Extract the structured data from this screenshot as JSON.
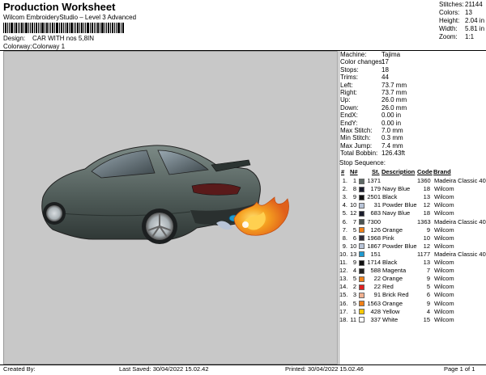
{
  "header": {
    "title": "Production Worksheet",
    "subtitle": "Wilcom EmbroideryStudio – Level 3 Advanced",
    "design_label": "Design:",
    "design_value": "CAR WITH nos 5,8IN",
    "colorway_label": "Colorway:",
    "colorway_value": "Colorway 1"
  },
  "stats": [
    {
      "k": "Stitches:",
      "v": "21144"
    },
    {
      "k": "Colors:",
      "v": "13"
    },
    {
      "k": "Height:",
      "v": "2.04 in"
    },
    {
      "k": "Width:",
      "v": "5.81 in"
    },
    {
      "k": "Zoom:",
      "v": "1:1"
    }
  ],
  "info": [
    {
      "k": "Machine:",
      "v": "Tajima"
    },
    {
      "k": "Color changes:",
      "v": "17"
    },
    {
      "k": "Stops:",
      "v": "18"
    },
    {
      "k": "Trims:",
      "v": "44"
    },
    {
      "k": "Left:",
      "v": "73.7 mm"
    },
    {
      "k": "Right:",
      "v": "73.7 mm"
    },
    {
      "k": "Up:",
      "v": "26.0 mm"
    },
    {
      "k": "Down:",
      "v": "26.0 mm"
    },
    {
      "k": "EndX:",
      "v": "0.00 in"
    },
    {
      "k": "EndY:",
      "v": "0.00 in"
    },
    {
      "k": "Max Stitch:",
      "v": "7.0 mm"
    },
    {
      "k": "Min Stitch:",
      "v": "0.3 mm"
    },
    {
      "k": "Max Jump:",
      "v": "7.4 mm"
    },
    {
      "k": "Total Bobbin:",
      "v": "126.43ft"
    }
  ],
  "sequence": {
    "title": "Stop Sequence:",
    "headers": {
      "n": "#",
      "num": "N#",
      "st": "St.",
      "desc": "Description",
      "code": "Code",
      "brand": "Brand"
    },
    "rows": [
      {
        "n": "1.",
        "num": "1",
        "color": "#5e6a66",
        "st": "1371",
        "desc": "",
        "code": "1360",
        "brand": "Madeira Classic 40"
      },
      {
        "n": "2.",
        "num": "8",
        "color": "#1a1c2c",
        "st": "179",
        "desc": "Navy Blue",
        "code": "18",
        "brand": "Wilcom"
      },
      {
        "n": "3.",
        "num": "9",
        "color": "#111111",
        "st": "2501",
        "desc": "Black",
        "code": "13",
        "brand": "Wilcom"
      },
      {
        "n": "4.",
        "num": "10",
        "color": "#b8c4d8",
        "st": "31",
        "desc": "Powder Blue",
        "code": "12",
        "brand": "Wilcom"
      },
      {
        "n": "5.",
        "num": "12",
        "color": "#1a1c2c",
        "st": "683",
        "desc": "Navy Blue",
        "code": "18",
        "brand": "Wilcom"
      },
      {
        "n": "6.",
        "num": "7",
        "color": "#4a5452",
        "st": "7300",
        "desc": "",
        "code": "1363",
        "brand": "Madeira Classic 40"
      },
      {
        "n": "7.",
        "num": "5",
        "color": "#f08018",
        "st": "126",
        "desc": "Orange",
        "code": "9",
        "brand": "Wilcom"
      },
      {
        "n": "8.",
        "num": "6",
        "color": "#2e2a38",
        "st": "1968",
        "desc": "Pink",
        "code": "10",
        "brand": "Wilcom"
      },
      {
        "n": "9.",
        "num": "10",
        "color": "#b8c4d8",
        "st": "1867",
        "desc": "Powder Blue",
        "code": "12",
        "brand": "Wilcom"
      },
      {
        "n": "10.",
        "num": "13",
        "color": "#1e9ad0",
        "st": "151",
        "desc": "",
        "code": "1177",
        "brand": "Madeira Classic 40"
      },
      {
        "n": "11.",
        "num": "9",
        "color": "#111111",
        "st": "1714",
        "desc": "Black",
        "code": "13",
        "brand": "Wilcom"
      },
      {
        "n": "12.",
        "num": "4",
        "color": "#222222",
        "st": "588",
        "desc": "Magenta",
        "code": "7",
        "brand": "Wilcom"
      },
      {
        "n": "13.",
        "num": "5",
        "color": "#f08018",
        "st": "22",
        "desc": "Orange",
        "code": "9",
        "brand": "Wilcom"
      },
      {
        "n": "14.",
        "num": "2",
        "color": "#e02020",
        "st": "22",
        "desc": "Red",
        "code": "5",
        "brand": "Wilcom"
      },
      {
        "n": "15.",
        "num": "3",
        "color": "#f0b090",
        "st": "91",
        "desc": "Brick Red",
        "code": "6",
        "brand": "Wilcom"
      },
      {
        "n": "16.",
        "num": "5",
        "color": "#f08018",
        "st": "1563",
        "desc": "Orange",
        "code": "9",
        "brand": "Wilcom"
      },
      {
        "n": "17.",
        "num": "1",
        "color": "#f8c800",
        "st": "428",
        "desc": "Yellow",
        "code": "4",
        "brand": "Wilcom"
      },
      {
        "n": "18.",
        "num": "11",
        "color": "#ffffff",
        "st": "337",
        "desc": "White",
        "code": "15",
        "brand": "Wilcom"
      }
    ]
  },
  "footer": {
    "created": "Created By:",
    "saved": "Last Saved: 30/04/2022 15.02.42",
    "printed": "Printed: 30/04/2022 15.02.46",
    "page": "Page 1 of 1"
  }
}
